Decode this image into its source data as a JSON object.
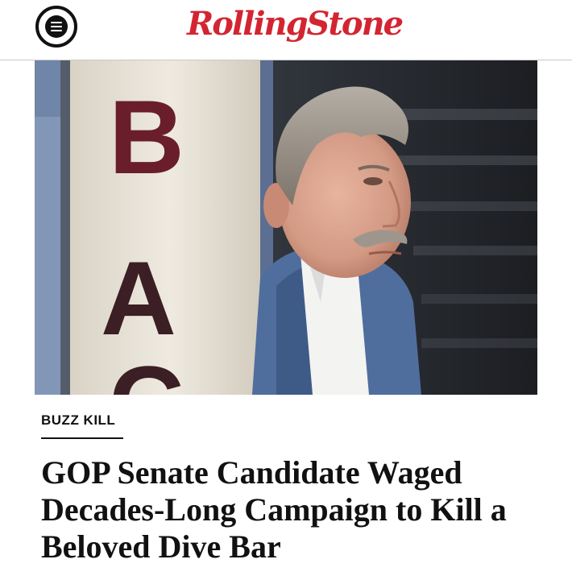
{
  "header": {
    "menu_icon": "hamburger-menu-icon",
    "logo_text": "RollingStone",
    "brand_color": "#d32531"
  },
  "hero": {
    "sign_letters": [
      "B",
      "A",
      "C"
    ]
  },
  "article": {
    "kicker": "BUZZ KILL",
    "headline": "GOP Senate Candidate Waged Decades-Long Campaign to Kill a Beloved Dive Bar"
  }
}
